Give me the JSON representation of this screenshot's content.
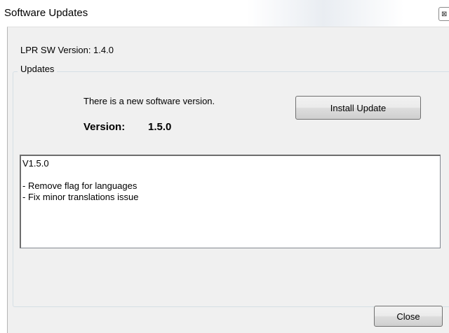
{
  "window": {
    "title": "Software Updates",
    "close_glyph": "⊠",
    "close_icon": "close-icon"
  },
  "current_version_text": "LPR SW Version: 1.4.0",
  "updates_group": {
    "label": "Updates",
    "message": "There is a new software version.",
    "version_label": "Version:",
    "version_value": "1.5.0",
    "install_button_label": "Install Update",
    "release_notes": "V1.5.0\n\n- Remove flag for languages\n- Fix minor translations issue"
  },
  "footer": {
    "close_button_label": "Close"
  }
}
